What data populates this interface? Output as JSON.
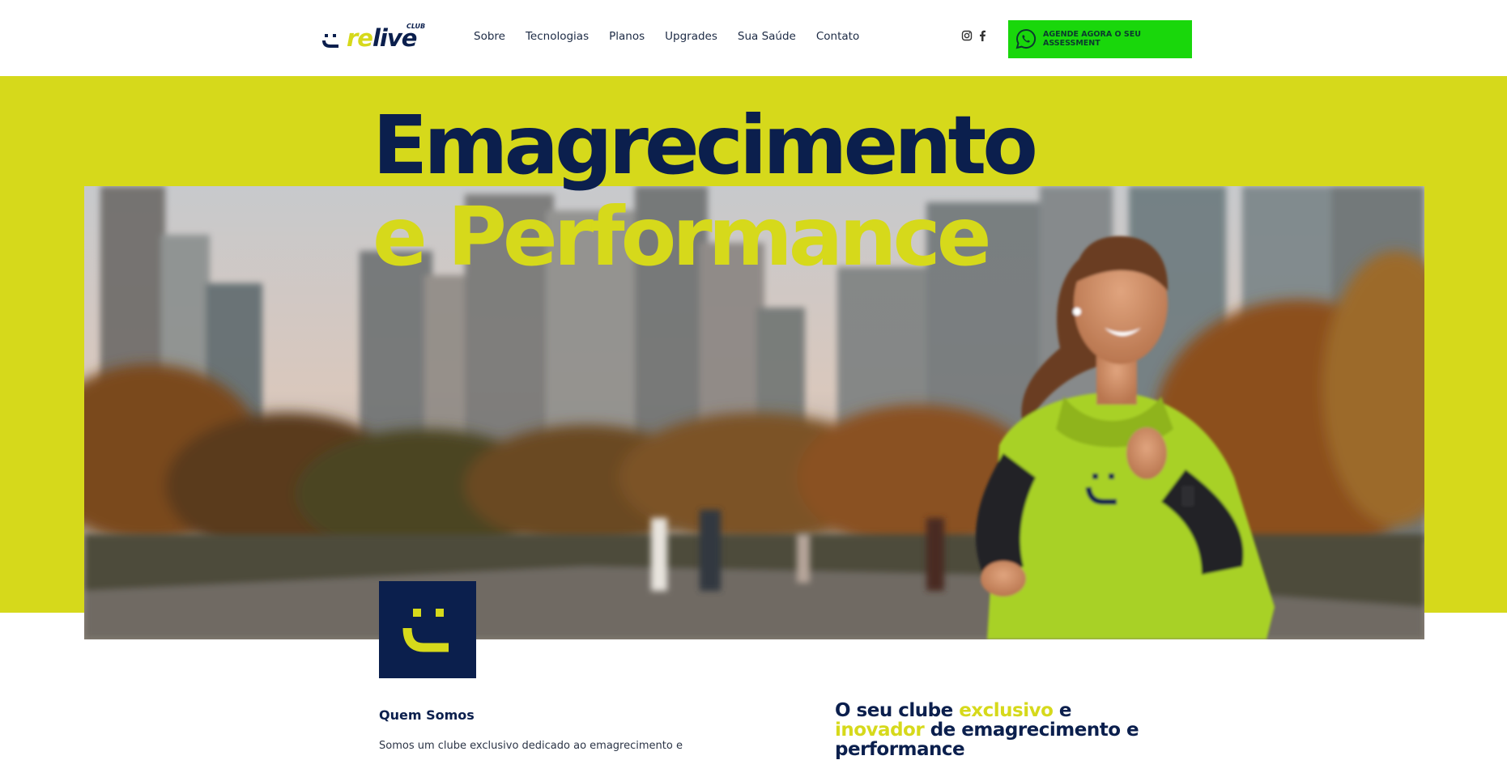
{
  "brand": {
    "logo_re": "re",
    "logo_live": "live",
    "logo_club": "CLUB",
    "accent_color": "#d6d91b",
    "navy_color": "#0b1f4d",
    "cta_color": "#19d70b"
  },
  "nav": {
    "items": [
      {
        "label": "Sobre"
      },
      {
        "label": "Tecnologias"
      },
      {
        "label": "Planos"
      },
      {
        "label": "Upgrades"
      },
      {
        "label": "Sua Saúde"
      },
      {
        "label": "Contato"
      }
    ]
  },
  "social": {
    "icons": [
      "instagram-icon",
      "facebook-icon"
    ]
  },
  "cta": {
    "icon": "whatsapp-icon",
    "label": "AGENDE AGORA O SEU ASSESSMENT"
  },
  "hero": {
    "title_line1": "Emagrecimento",
    "title_line2": "e Performance",
    "image_icon": "smiley-logo-icon"
  },
  "about": {
    "title": "Quem Somos",
    "text": "Somos um clube exclusivo dedicado ao emagrecimento e"
  },
  "headline": {
    "part1": "O seu clube ",
    "part2": "exclusivo",
    "part3": " e ",
    "part4": "inovador",
    "part5": " de emagrecimento e performance"
  }
}
